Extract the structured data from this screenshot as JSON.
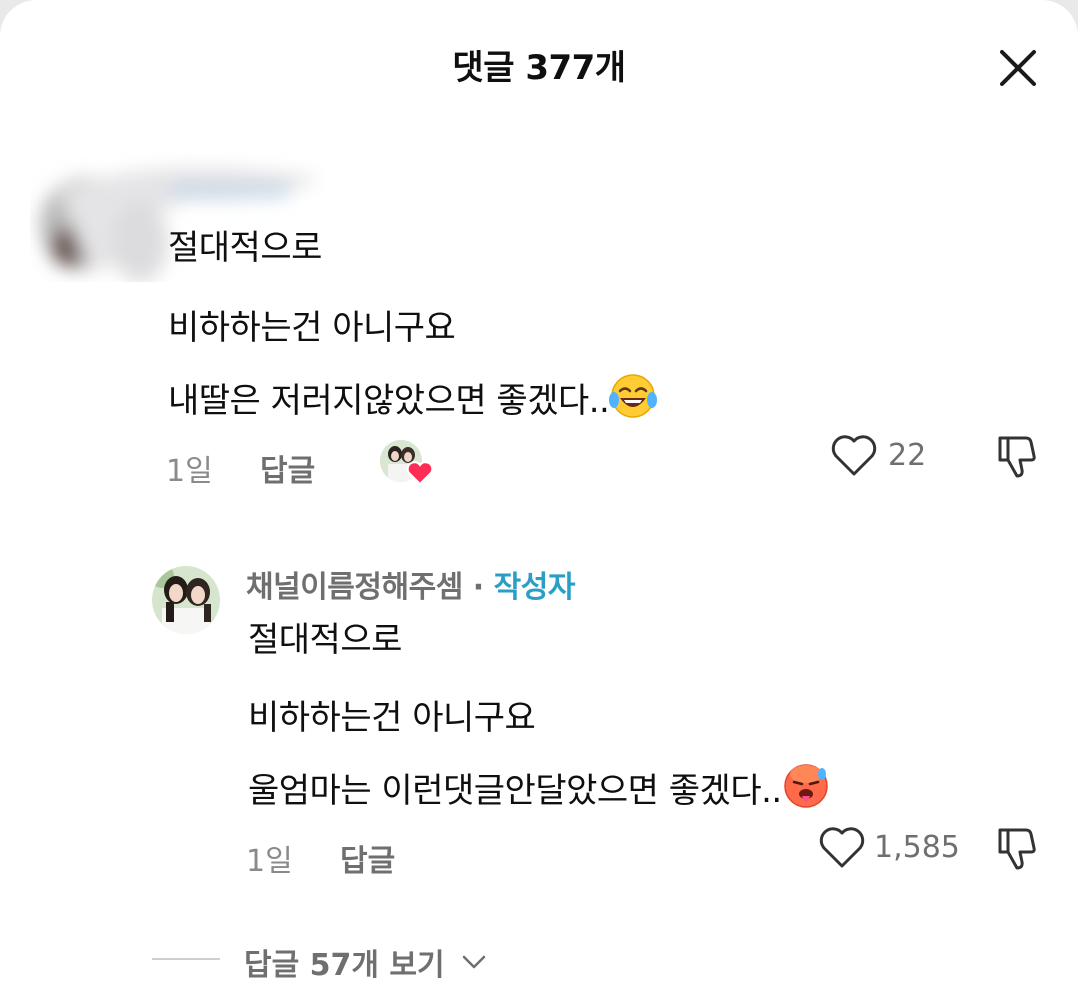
{
  "header": {
    "title": "댓글 377개"
  },
  "comment": {
    "lines": [
      "절대적으로",
      "비하하는건 아니구요",
      "내딸은 저러지않았으면 좋겠다.."
    ],
    "time": "1일",
    "reply_label": "답글",
    "likes": "22"
  },
  "reply": {
    "author": "채널이름정해주셈",
    "separator": "·",
    "badge": "작성자",
    "lines": [
      "절대적으로",
      "비하하는건 아니구요",
      "울엄마는 이런댓글안달았으면 좋겠다.."
    ],
    "time": "1일",
    "reply_label": "답글",
    "likes": "1,585"
  },
  "view_replies": {
    "label": "답글 57개 보기"
  },
  "colors": {
    "accent": "#2a9ec4",
    "heart": "#ff2d55",
    "muted": "#6f6f6f"
  },
  "icons": [
    "close-icon",
    "heart-icon",
    "dislike-icon",
    "chevron-down-icon",
    "tears-of-joy-emoji",
    "hot-face-emoji"
  ]
}
